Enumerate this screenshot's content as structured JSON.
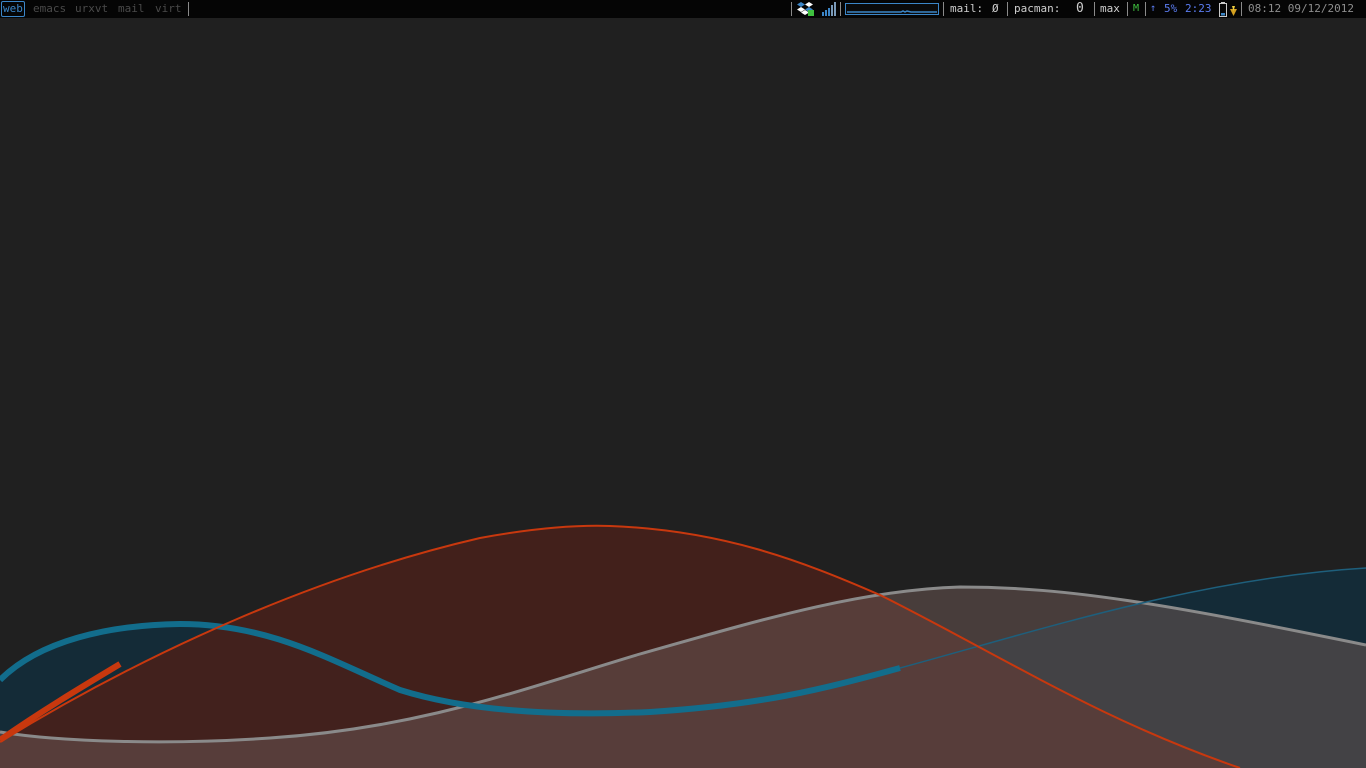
{
  "taskbar": {
    "workspaces": [
      {
        "label": "web",
        "active": true
      },
      {
        "label": "emacs",
        "active": false
      },
      {
        "label": "urxvt",
        "active": false
      },
      {
        "label": "mail",
        "active": false
      },
      {
        "label": "virt",
        "active": false
      }
    ],
    "tray": {
      "dropbox_icon": "dropbox-icon",
      "signal_icon": "wifi-signal-icon",
      "network_graph": "network-activity-graph"
    },
    "mail_label": "mail:",
    "mail_value": "Ø",
    "pacman_label": "pacman:",
    "pacman_value": "0",
    "layout": "max",
    "layout_indicator": "M",
    "battery_arrow": "↑",
    "battery_percent": "5%",
    "battery_time": "2:23",
    "battery_icon": "battery-icon",
    "clock": "08:12 09/12/2012"
  },
  "colors": {
    "background": "#202020",
    "bar": "#050505",
    "accent_blue": "#3b86c8",
    "orange_wave": "#c8380e",
    "blue_wave": "#126d8c",
    "gray_wave": "#8a8a8a",
    "layout_green": "#3fc03f",
    "battery_blue": "#5b7cf0"
  }
}
